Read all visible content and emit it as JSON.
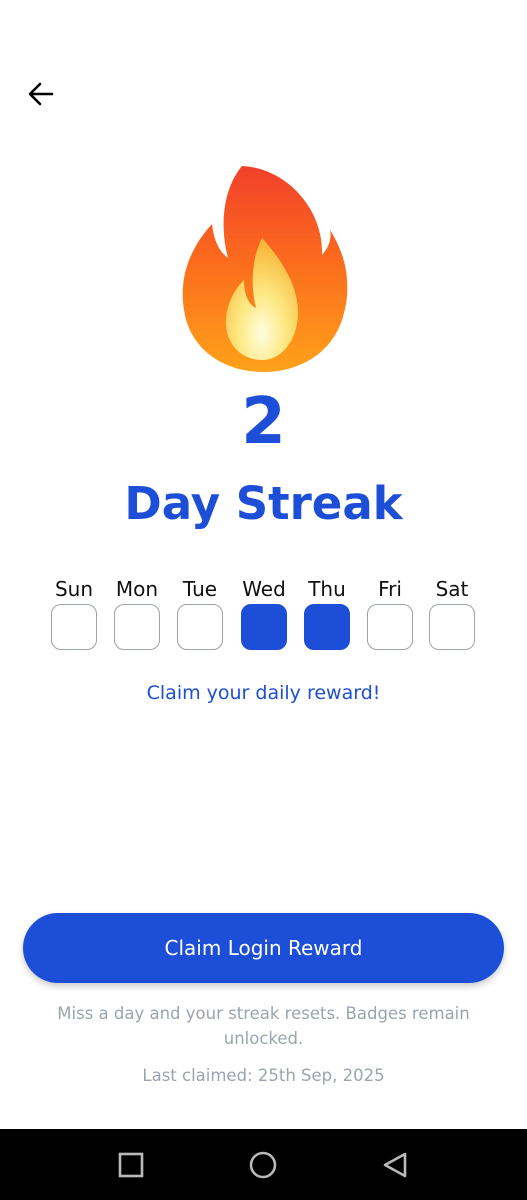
{
  "header": {
    "back_icon": "arrow-left-icon"
  },
  "hero": {
    "icon": "fire-icon",
    "streak_count": "2",
    "streak_label": "Day Streak"
  },
  "week": {
    "days": [
      {
        "label": "Sun",
        "completed": false
      },
      {
        "label": "Mon",
        "completed": false
      },
      {
        "label": "Tue",
        "completed": false
      },
      {
        "label": "Wed",
        "completed": true
      },
      {
        "label": "Thu",
        "completed": true
      },
      {
        "label": "Fri",
        "completed": false
      },
      {
        "label": "Sat",
        "completed": false
      }
    ]
  },
  "reward_hint": "Claim your daily reward!",
  "claim_button": {
    "label": "Claim Login Reward"
  },
  "disclaimer": "Miss a day and your streak resets. Badges remain unlocked.",
  "last_claimed": "Last claimed: 25th Sep, 2025",
  "colors": {
    "accent": "#1d4ed8",
    "muted_text": "#9ca3af",
    "day_border": "#9ca3af",
    "nav_bar": "#000000"
  },
  "system_nav": {
    "recents_icon": "square-icon",
    "home_icon": "circle-icon",
    "back_icon": "triangle-back-icon"
  }
}
